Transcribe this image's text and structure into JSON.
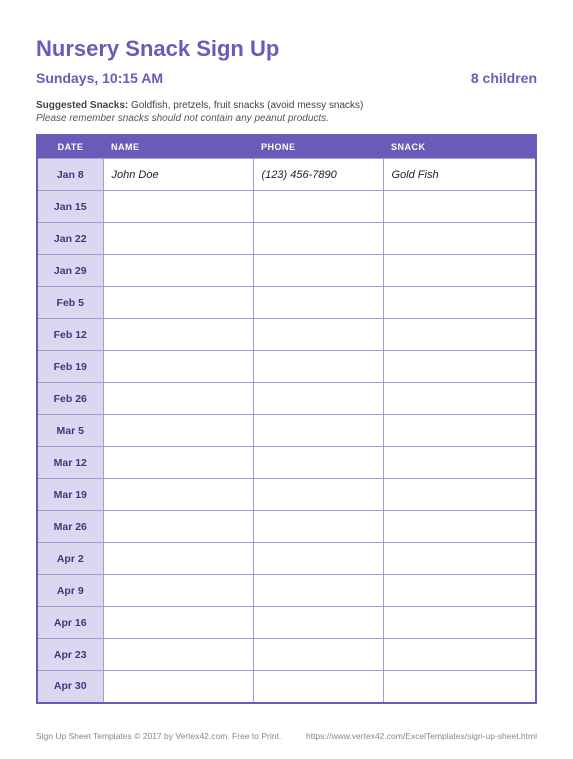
{
  "title": "Nursery Snack Sign Up",
  "subtitle_left": "Sundays, 10:15 AM",
  "subtitle_right": "8 children",
  "suggested_label": "Suggested Snacks:",
  "suggested_text": " Goldfish, pretzels, fruit snacks (avoid messy snacks)",
  "reminder": "Please remember snacks should not contain any peanut products.",
  "columns": {
    "date": "DATE",
    "name": "NAME",
    "phone": "PHONE",
    "snack": "SNACK"
  },
  "rows": [
    {
      "date": "Jan 8",
      "name": "John Doe",
      "phone": "(123) 456-7890",
      "snack": "Gold Fish"
    },
    {
      "date": "Jan 15",
      "name": "",
      "phone": "",
      "snack": ""
    },
    {
      "date": "Jan 22",
      "name": "",
      "phone": "",
      "snack": ""
    },
    {
      "date": "Jan 29",
      "name": "",
      "phone": "",
      "snack": ""
    },
    {
      "date": "Feb 5",
      "name": "",
      "phone": "",
      "snack": ""
    },
    {
      "date": "Feb 12",
      "name": "",
      "phone": "",
      "snack": ""
    },
    {
      "date": "Feb 19",
      "name": "",
      "phone": "",
      "snack": ""
    },
    {
      "date": "Feb 26",
      "name": "",
      "phone": "",
      "snack": ""
    },
    {
      "date": "Mar 5",
      "name": "",
      "phone": "",
      "snack": ""
    },
    {
      "date": "Mar 12",
      "name": "",
      "phone": "",
      "snack": ""
    },
    {
      "date": "Mar 19",
      "name": "",
      "phone": "",
      "snack": ""
    },
    {
      "date": "Mar 26",
      "name": "",
      "phone": "",
      "snack": ""
    },
    {
      "date": "Apr 2",
      "name": "",
      "phone": "",
      "snack": ""
    },
    {
      "date": "Apr 9",
      "name": "",
      "phone": "",
      "snack": ""
    },
    {
      "date": "Apr 16",
      "name": "",
      "phone": "",
      "snack": ""
    },
    {
      "date": "Apr 23",
      "name": "",
      "phone": "",
      "snack": ""
    },
    {
      "date": "Apr 30",
      "name": "",
      "phone": "",
      "snack": ""
    }
  ],
  "footer_left": "Sign Up Sheet Templates © 2017 by Vertex42.com. Free to Print.",
  "footer_right": "https://www.vertex42.com/ExcelTemplates/sign-up-sheet.html"
}
